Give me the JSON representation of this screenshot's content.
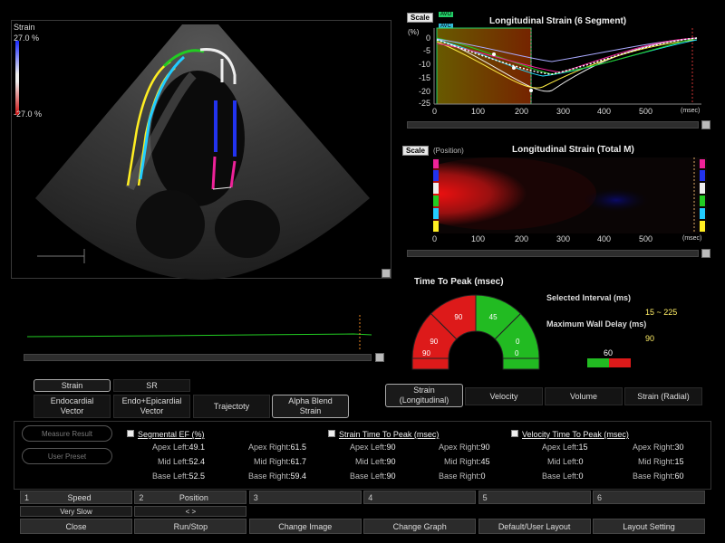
{
  "echo": {
    "strain_label": "Strain",
    "max": "27.0 %",
    "min": "-27.0 %"
  },
  "curve": {
    "scale": "Scale",
    "avo": "AVO",
    "avc": "AVC",
    "unit": "(%)",
    "title": "Longitudinal Strain (6 Segment)",
    "yticks": [
      "0",
      "-5",
      "-10",
      "-15",
      "-20",
      "-25"
    ],
    "xticks": [
      "0",
      "100",
      "200",
      "300",
      "400",
      "500"
    ],
    "xunit": "(msec)"
  },
  "mmode": {
    "scale": "Scale",
    "position": "(Position)",
    "title": "Longitudinal Strain (Total M)",
    "xticks": [
      "0",
      "100",
      "200",
      "300",
      "400",
      "500"
    ],
    "xunit": "(msec)"
  },
  "ttp": {
    "title": "Time To Peak (msec)",
    "segments": [
      "90",
      "90",
      "90",
      "45",
      "0",
      "90"
    ],
    "segment_colors": [
      "#dd1a1a",
      "#dd1a1a",
      "#dd1a1a",
      "#22bb22",
      "#22bb22",
      "#dd1a1a"
    ],
    "selected_interval_label": "Selected Interval (ms)",
    "selected_interval": "15 ~ 225",
    "max_wall_delay_label": "Maximum Wall Delay (ms)",
    "max_wall_delay": "90",
    "delay_bar_value": "60"
  },
  "mode_tabs": {
    "strain": "Strain",
    "sr": "SR"
  },
  "display_buttons": {
    "endocardial": "Endocardial\nVector",
    "endo_epi": "Endo+Epicardial\nVector",
    "trajectory": "Trajectoty",
    "alpha_blend": "Alpha Blend\nStrain"
  },
  "param_tabs": {
    "strain_long": "Strain\n(Longitudinal)",
    "velocity": "Velocity",
    "volume": "Volume",
    "strain_radial": "Strain (Radial)"
  },
  "buttons": {
    "measure_result": "Measure Result",
    "user_preset": "User Preset"
  },
  "segmental_ef": {
    "title": "Segmental EF (%)",
    "rows": [
      {
        "l": "Apex Left",
        "lv": ":49.1",
        "r": "Apex Right",
        "rv": ":61.5"
      },
      {
        "l": "Mid Left",
        "lv": ":52.4",
        "r": "Mid Right",
        "rv": ":61.7"
      },
      {
        "l": "Base Left",
        "lv": ":52.5",
        "r": "Base Right",
        "rv": ":59.4"
      }
    ]
  },
  "strain_ttp": {
    "title": "Strain Time To Peak (msec)",
    "rows": [
      {
        "l": "Apex Left",
        "lv": ":90",
        "r": "Apex Right",
        "rv": ":90"
      },
      {
        "l": "Mid Left",
        "lv": ":90",
        "r": "Mid Right",
        "rv": ":45"
      },
      {
        "l": "Base Left",
        "lv": ":90",
        "r": "Base Right",
        "rv": ":0"
      }
    ]
  },
  "velocity_ttp": {
    "title": "Velocity Time To Peak (msec)",
    "rows": [
      {
        "l": "Apex Left",
        "lv": ":15",
        "r": "Apex Right",
        "rv": ":30"
      },
      {
        "l": "Mid Left",
        "lv": ":0",
        "r": "Mid Right",
        "rv": ":15"
      },
      {
        "l": "Base Left",
        "lv": ":0",
        "r": "Base Right",
        "rv": ":60"
      }
    ]
  },
  "softkeys": [
    {
      "num": "1",
      "top": "Speed",
      "sub": "Very Slow",
      "bottom": "Close"
    },
    {
      "num": "2",
      "top": "Position",
      "sub": "< >",
      "bottom": "Run/Stop"
    },
    {
      "num": "3",
      "top": "",
      "sub": "",
      "bottom": "Change Image"
    },
    {
      "num": "4",
      "top": "",
      "sub": "",
      "bottom": "Change Graph"
    },
    {
      "num": "5",
      "top": "",
      "sub": "",
      "bottom": "Default/User Layout"
    },
    {
      "num": "6",
      "top": "",
      "sub": "",
      "bottom": "Layout Setting"
    }
  ]
}
